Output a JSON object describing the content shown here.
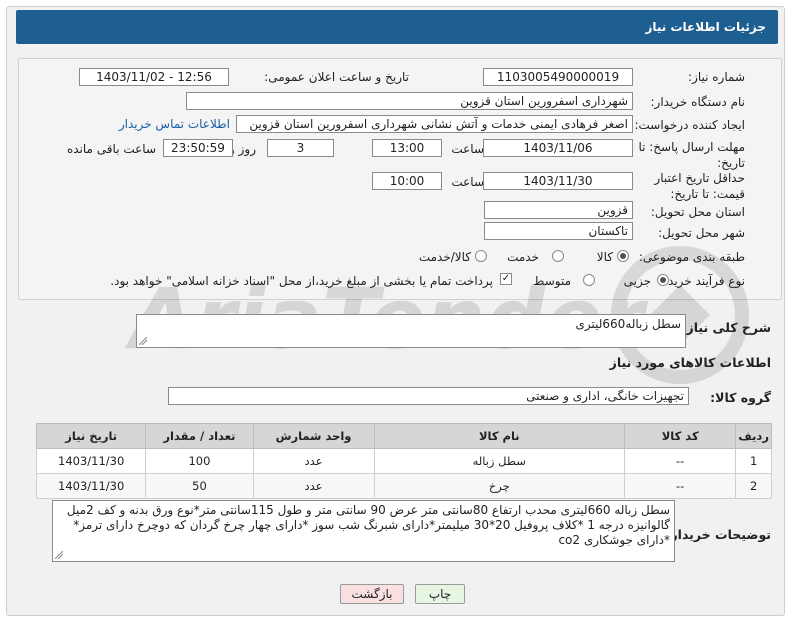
{
  "title": "جزئیات اطلاعات نیاز",
  "form": {
    "need_number_label": "شماره نیاز:",
    "need_number": "1103005490000019",
    "announce_label": "تاریخ و ساعت اعلان عمومی:",
    "announce_value": "1403/11/02 - 12:56",
    "buyer_org_label": "نام دستگاه خریدار:",
    "buyer_org": "شهرداری اسفرورین استان قزوین",
    "requester_label": "ایجاد کننده درخواست:",
    "requester": "اصغر فرهادی ایمنی خدمات و آتش نشانی شهرداری اسفرورین استان قزوین",
    "contact_link": "اطلاعات تماس خریدار",
    "reply_deadline_label": "مهلت ارسال پاسخ: تا تاریخ:",
    "reply_date": "1403/11/06",
    "time_label": "ساعت",
    "reply_time": "13:00",
    "days_value": "3",
    "days_label": "روز و",
    "remaining_time": "23:50:59",
    "remaining_label": "ساعت باقی مانده",
    "validity_label": "حداقل تاریخ اعتبار قیمت: تا تاریخ:",
    "validity_date": "1403/11/30",
    "validity_time_label": "ساعت",
    "validity_time": "10:00",
    "province_label": "استان محل تحویل:",
    "province": "قزوین",
    "city_label": "شهر محل تحویل:",
    "city": "تاکستان",
    "category_label": "طبقه بندی موضوعی:",
    "category_options": [
      "کالا",
      "خدمت",
      "کالا/خدمت"
    ],
    "process_label": "نوع فرآیند خرید :",
    "process_options": [
      "جزیی",
      "متوسط"
    ],
    "payment_note": "پرداخت تمام یا بخشی از مبلغ خرید،از محل \"اسناد خزانه اسلامی\" خواهد بود."
  },
  "description": {
    "label": "شرح کلی نیاز:",
    "value": "سطل زباله660لیتری"
  },
  "goods_section_title": "اطلاعات کالاهای مورد نیاز",
  "goods_group": {
    "label": "گروه کالا:",
    "value": "تجهیزات خانگی، اداری و صنعتی"
  },
  "table": {
    "headers": [
      "ردیف",
      "کد کالا",
      "نام کالا",
      "واحد شمارش",
      "تعداد / مقدار",
      "تاریخ نیاز"
    ],
    "rows": [
      [
        "1",
        "--",
        "سطل زباله",
        "عدد",
        "100",
        "1403/11/30"
      ],
      [
        "2",
        "--",
        "چرخ",
        "عدد",
        "50",
        "1403/11/30"
      ]
    ]
  },
  "buyer_notes": {
    "label": "توضیحات خریدار:",
    "value": "سطل زباله 660لیتری  محدب   ارتفاع 80سانتی متر عرض 90  سانتی متر و طول 115سانتی متر*نوع ورق بدنه  و کف 2میل گالوانیزه درجه 1 *کلاف پروفیل 20*30 میلیمتر*دارای شبرنگ شب سوز *دارای چهار چرخ گردان که دوچرخ دارای ترمز* *دارای جوشکاری co2"
  },
  "buttons": {
    "print": "چاپ",
    "back": "بازگشت"
  },
  "colors": {
    "title_bar": "#1d5f91",
    "link": "#1a5fa8",
    "print_btn": "#e7f6e2",
    "back_btn": "#f9e1e1"
  }
}
